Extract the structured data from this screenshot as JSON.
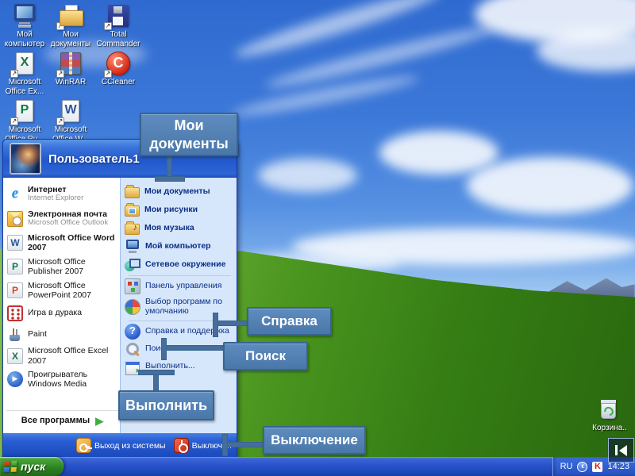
{
  "desktop": {
    "icons": [
      {
        "label": "Мой компьютер",
        "icon": "my-computer-icon"
      },
      {
        "label": "Мои документы",
        "icon": "documents-folder-icon"
      },
      {
        "label": "Total Commander",
        "icon": "floppy-disk-icon"
      },
      {
        "label": "Microsoft Office Ex...",
        "icon": "excel-icon"
      },
      {
        "label": "WinRAR",
        "icon": "winrar-books-icon"
      },
      {
        "label": "CCleaner",
        "icon": "ccleaner-icon"
      },
      {
        "label": "Microsoft Office Pu...",
        "icon": "publisher-icon"
      },
      {
        "label": "Microsoft Office W...",
        "icon": "word-icon"
      }
    ],
    "recycle_bin_label": "Корзина.."
  },
  "start_menu": {
    "user_name": "Пользователь1",
    "left_items": [
      {
        "title": "Интернет",
        "subtitle": "Internet Explorer",
        "icon": "internet-explorer-icon"
      },
      {
        "title": "Электронная почта",
        "subtitle": "Microsoft Office Outlook",
        "icon": "outlook-icon"
      },
      {
        "title": "Microsoft Office Word 2007",
        "icon": "word-icon"
      },
      {
        "title": "Microsoft Office Publisher 2007",
        "icon": "publisher-icon"
      },
      {
        "title": "Microsoft Office PowerPoint 2007",
        "icon": "powerpoint-icon"
      },
      {
        "title": "Игра в дурака",
        "icon": "dice-game-icon"
      },
      {
        "title": "Paint",
        "icon": "paint-icon"
      },
      {
        "title": "Microsoft Office Excel 2007",
        "icon": "excel-icon"
      },
      {
        "title": "Проигрыватель Windows Media",
        "icon": "windows-media-player-icon"
      }
    ],
    "all_programs_label": "Все программы",
    "right_items": [
      {
        "label": "Мои документы",
        "icon": "folder-icon"
      },
      {
        "label": "Мои рисунки",
        "icon": "pictures-folder-icon"
      },
      {
        "label": "Моя музыка",
        "icon": "music-folder-icon"
      },
      {
        "label": "Мой компьютер",
        "icon": "computer-icon"
      },
      {
        "label": "Сетевое окружение",
        "icon": "network-icon"
      },
      {
        "label": "Панель управления",
        "icon": "control-panel-icon"
      },
      {
        "label": "Выбор программ по умолчанию",
        "icon": "default-programs-icon"
      },
      {
        "label": "Справка и поддержка",
        "icon": "help-icon"
      },
      {
        "label": "Поиск",
        "icon": "search-icon"
      },
      {
        "label": "Выполнить...",
        "icon": "run-icon"
      }
    ],
    "logoff_label": "Выход из системы",
    "shutdown_label": "Выключен"
  },
  "callouts": {
    "my_documents": "Мои документы",
    "help": "Справка",
    "search": "Поиск",
    "run": "Выполнить",
    "shutdown": "Выключение"
  },
  "taskbar": {
    "start_label": "пуск",
    "tray": {
      "language": "RU",
      "time": "14:23"
    }
  },
  "colors": {
    "callout_fill": "#5282b8",
    "callout_border": "#38658f",
    "taskbar_blue": "#2a52c8",
    "start_button_green": "#2f8a24",
    "menu_right_bg": "#d6e6fb"
  }
}
